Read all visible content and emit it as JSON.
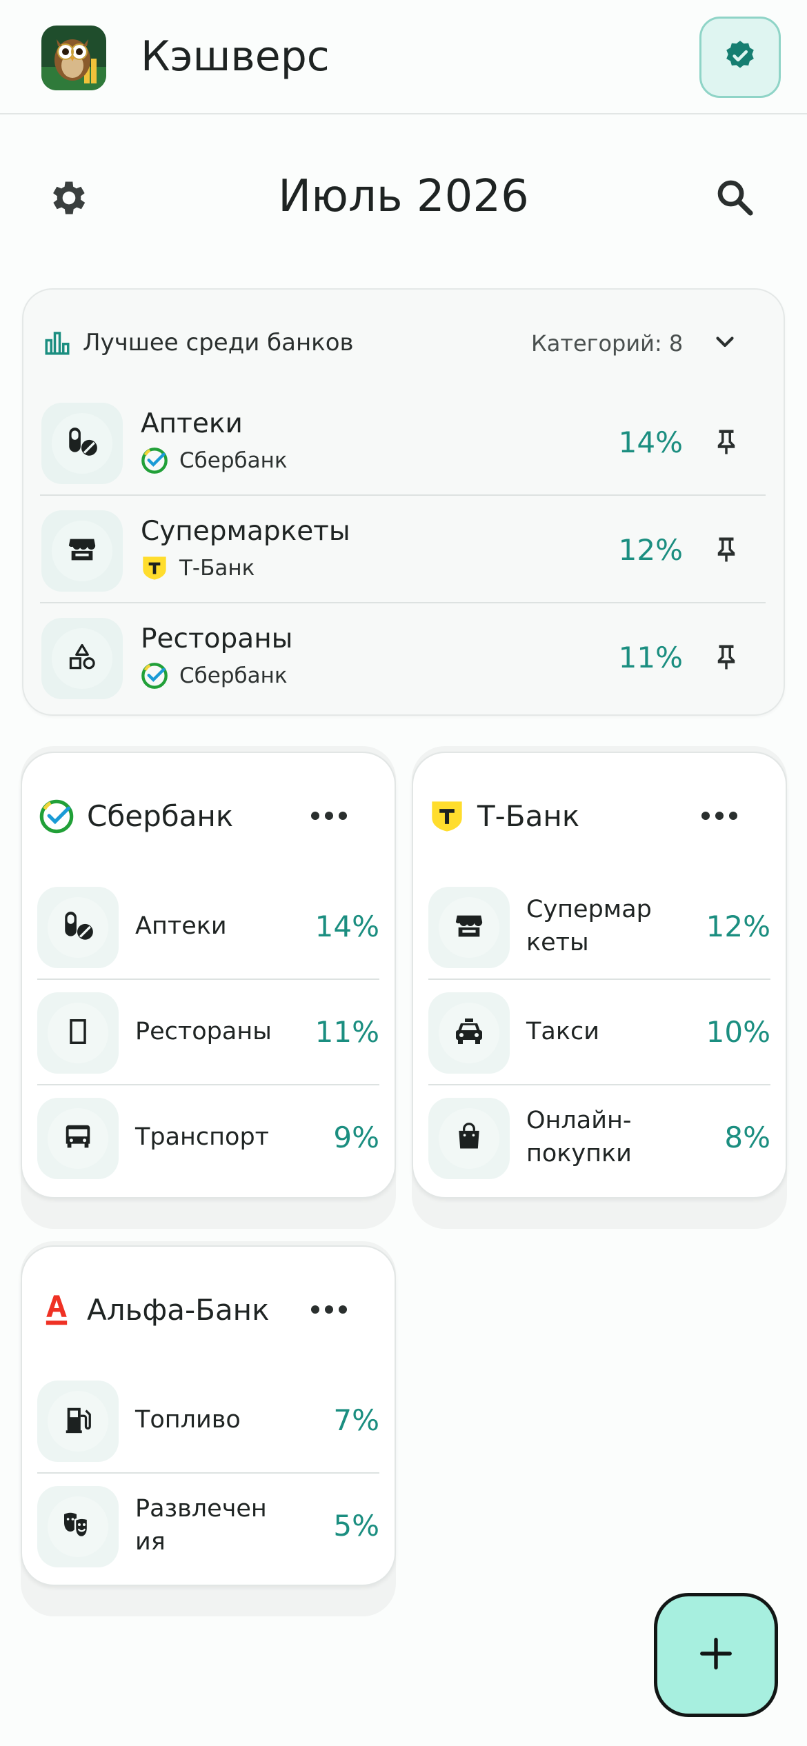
{
  "app": {
    "title": "Кэшверс"
  },
  "header": {
    "month": "Июль 2026"
  },
  "best": {
    "title": "Лучшее среди банков",
    "count_label": "Категорий: 8",
    "rows": [
      {
        "name": "Аптеки",
        "bank": "Сбербанк",
        "percent": "14%"
      },
      {
        "name": "Супермаркеты",
        "bank": "Т-Банк",
        "percent": "12%"
      },
      {
        "name": "Рестораны",
        "bank": "Сбербанк",
        "percent": "11%"
      }
    ]
  },
  "banks": [
    {
      "name": "Сбербанк",
      "categories": [
        {
          "name": "Аптеки",
          "percent": "14%"
        },
        {
          "name": "Рестораны",
          "percent": "11%"
        },
        {
          "name": "Транспорт",
          "percent": "9%"
        }
      ]
    },
    {
      "name": "Т-Банк",
      "categories": [
        {
          "name": "Супермаркеты",
          "percent": "12%"
        },
        {
          "name": "Такси",
          "percent": "10%"
        },
        {
          "name": "Онлайн-покупки",
          "percent": "8%"
        }
      ]
    },
    {
      "name": "Альфа-Банк",
      "categories": [
        {
          "name": "Топливо",
          "percent": "7%"
        },
        {
          "name": "Развлечения",
          "percent": "5%"
        }
      ]
    }
  ],
  "icons": {
    "verified": "verified-badge-icon",
    "settings": "gear-icon",
    "search": "search-icon",
    "stats": "bar-chart-icon",
    "expand": "chevron-down-icon",
    "pin": "pin-icon",
    "more": "more-horizontal-icon",
    "add": "plus-icon"
  },
  "colors": {
    "accent": "#1b8e80",
    "fab": "#a7efdf",
    "sber": "#21a038",
    "tbank": "#ffdd2d",
    "alfa": "#ef3124"
  }
}
